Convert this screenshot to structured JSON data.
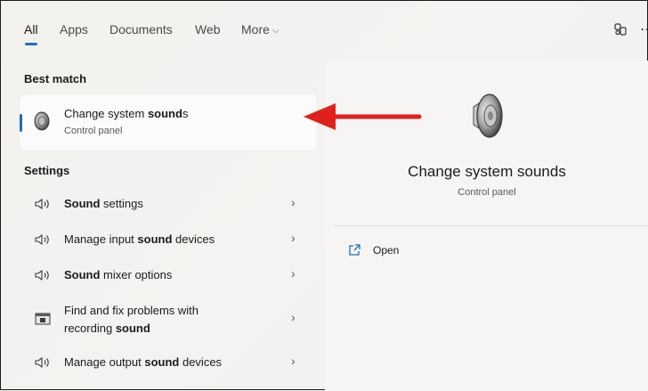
{
  "tabs": [
    {
      "label": "All"
    },
    {
      "label": "Apps"
    },
    {
      "label": "Documents"
    },
    {
      "label": "Web"
    },
    {
      "label": "More"
    }
  ],
  "icons": {
    "share": "share-icon",
    "more": "more-icon"
  },
  "best_match": {
    "heading": "Best match",
    "title_pre": "Change system ",
    "title_bold": "sound",
    "title_post": "s",
    "subtitle": "Control panel"
  },
  "settings": {
    "heading": "Settings",
    "items": [
      {
        "pre": "",
        "bold": "Sound",
        "post": " settings",
        "icon": "speaker-icon"
      },
      {
        "pre": "Manage input ",
        "bold": "sound",
        "post": " devices",
        "icon": "speaker-icon"
      },
      {
        "pre": "",
        "bold": "Sound",
        "post": " mixer options",
        "icon": "speaker-icon"
      },
      {
        "line1": "Find and fix problems with",
        "pre": "recording ",
        "bold": "sound",
        "post": "",
        "icon": "troubleshoot-icon"
      },
      {
        "pre": "Manage output ",
        "bold": "sound",
        "post": " devices",
        "icon": "speaker-icon"
      }
    ]
  },
  "preview": {
    "title": "Change system sounds",
    "subtitle": "Control panel",
    "action_open": "Open"
  },
  "colors": {
    "accent": "#1f6fb7",
    "annotation": "#e0201a"
  }
}
